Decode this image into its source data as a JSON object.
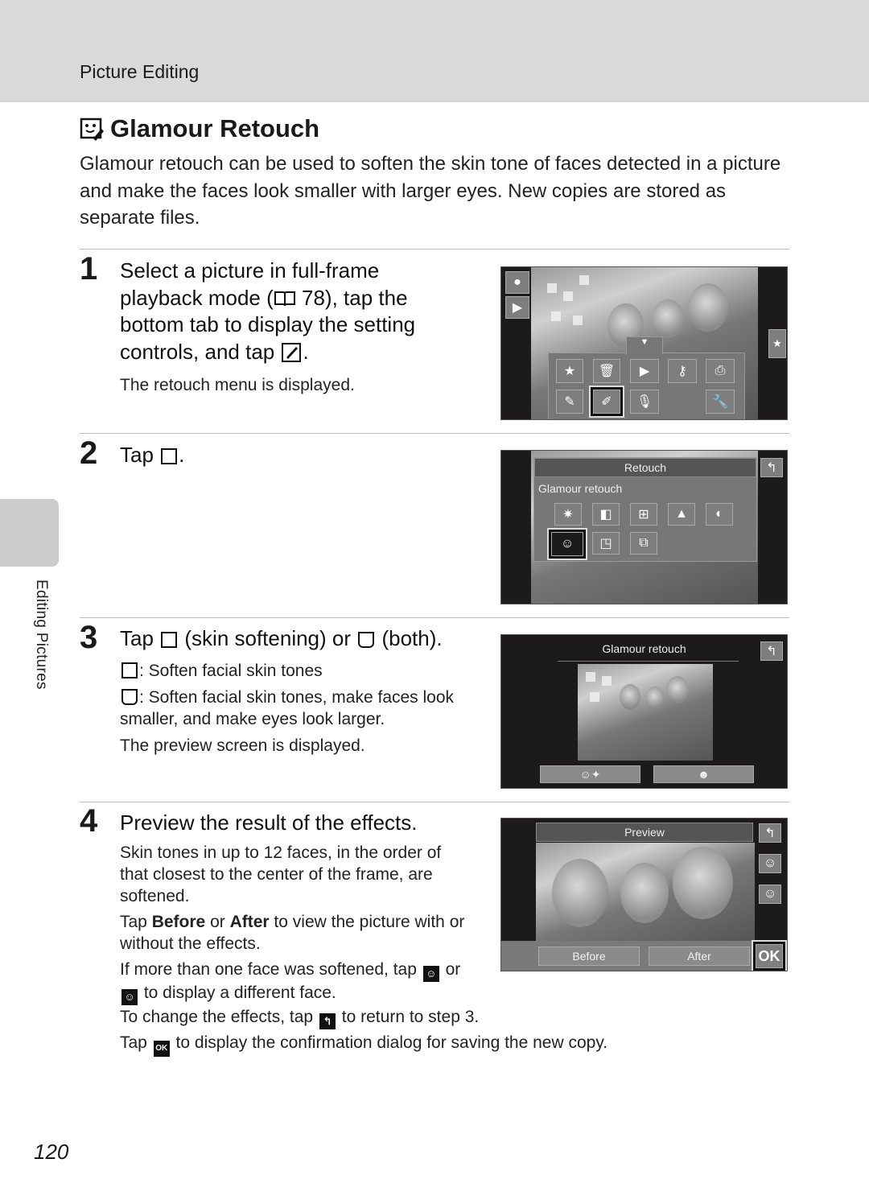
{
  "header": {
    "section": "Picture Editing"
  },
  "side_tab": {
    "label": "Editing Pictures"
  },
  "page_title": {
    "icon": "glamour-retouch-icon",
    "text": "Glamour Retouch"
  },
  "intro": "Glamour retouch can be used to soften the skin tone of faces detected in a picture and make the faces look smaller with larger eyes. New copies are stored as separate files.",
  "steps": [
    {
      "number": "1",
      "head_parts": [
        "Select a picture in full-frame playback mode (",
        " 78), tap the bottom tab to display the setting controls, and tap ",
        "."
      ],
      "notes": [
        "The retouch menu is displayed."
      ],
      "screen": {
        "left_buttons": [
          "camera-icon",
          "playback-icon"
        ],
        "right_button": "star-icon",
        "tab_arrow": "▼",
        "menu_row1": [
          "favorites-folder-icon",
          "delete-icon",
          "slideshow-icon",
          "protect-key-icon",
          "print-icon"
        ],
        "menu_row2": [
          "paint-icon",
          "retouch-icon",
          "voice-memo-icon",
          "",
          "setup-wrench-icon"
        ],
        "selected": "retouch-icon"
      }
    },
    {
      "number": "2",
      "head_parts": [
        "Tap ",
        "."
      ],
      "screen": {
        "title": "Retouch",
        "subtitle": "Glamour retouch",
        "back_icon": "back-arrow-icon",
        "row1": [
          "quick-retouch-icon",
          "d-lighting-icon",
          "red-eye-icon",
          "perspective-icon",
          "filter-icon"
        ],
        "row2": [
          "glamour-retouch-icon",
          "small-picture-icon",
          "crop-icon"
        ],
        "selected": "glamour-retouch-icon"
      }
    },
    {
      "number": "3",
      "head_parts": [
        "Tap ",
        " (skin softening) or ",
        " (both)."
      ],
      "notes": [
        ": Soften facial skin tones",
        ": Soften facial skin tones, make faces look smaller, and make eyes look larger.",
        "The preview screen is displayed."
      ],
      "screen": {
        "title": "Glamour retouch",
        "back_icon": "back-arrow-icon",
        "options": [
          "skin-softening-icon",
          "both-effects-icon"
        ]
      }
    },
    {
      "number": "4",
      "head": "Preview the result of the effects.",
      "notes": [
        "Skin tones in up to 12 faces, in the order of that closest to the center of the frame, are softened.",
        {
          "pre": "Tap ",
          "b1": "Before",
          "mid": " or ",
          "b2": "After",
          "post": " to view the picture with or without the effects."
        },
        {
          "pre": "If more than one face was softened, tap ",
          "mid": " or ",
          "post": " to display a different face."
        },
        {
          "pre": "To change the effects, tap ",
          "post": " to return to step 3."
        },
        {
          "pre": "Tap ",
          "post": " to display the confirmation dialog for saving the new copy."
        }
      ],
      "screen": {
        "title": "Preview",
        "before_label": "Before",
        "after_label": "After",
        "ok_label": "OK",
        "side_icons": [
          "back-arrow-icon",
          "next-face-icon",
          "previous-face-icon"
        ]
      }
    }
  ],
  "page_number": "120"
}
